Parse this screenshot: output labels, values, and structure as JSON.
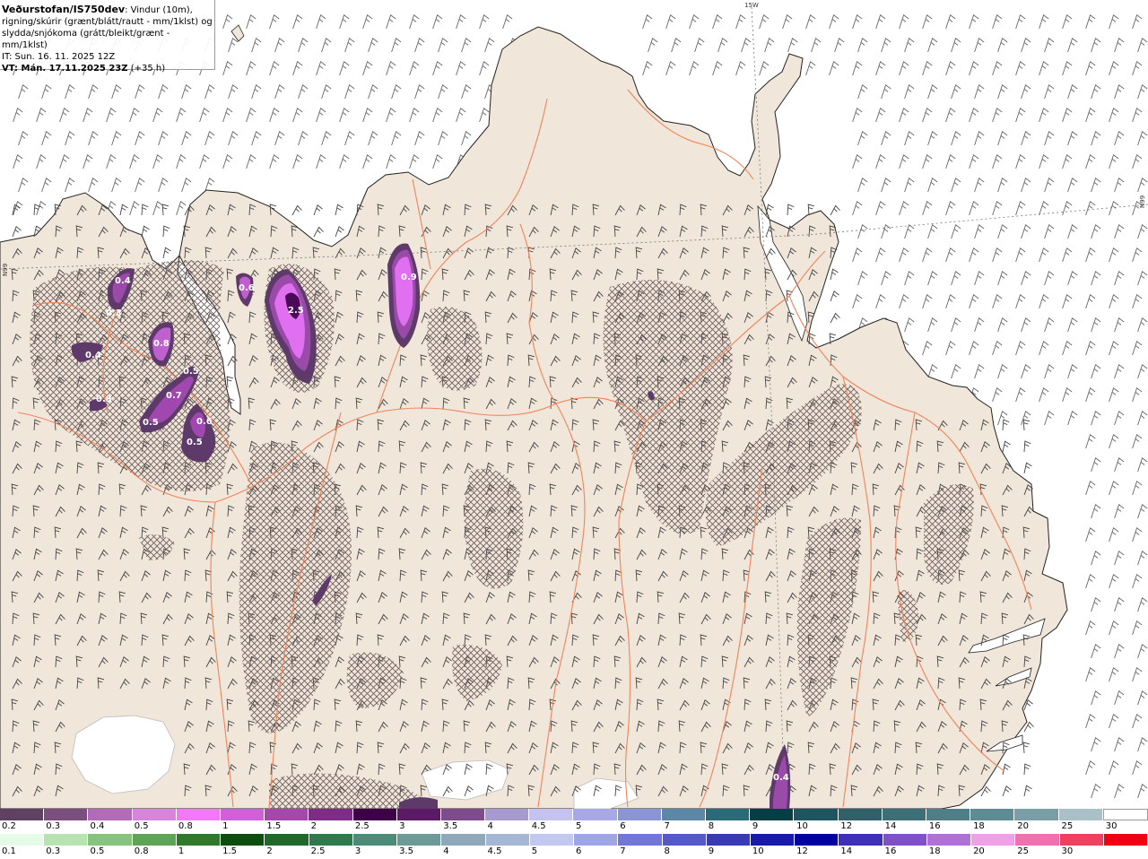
{
  "header": {
    "product": "Veðurstofan/IS750dev",
    "desc_line1": ": Vindur (10m),",
    "desc_line2": "rigning/skúrir (grænt/blátt/rautt - mm/1klst) og",
    "desc_line3": "slydda/snjókoma (grátt/bleikt/grænt - mm/1klst)",
    "issue_time": "IT: Sun. 16. 11. 2025 12Z",
    "valid_prefix": "VT: Mán. 17.11.2025 23Z",
    "valid_suffix": " (+35 h)"
  },
  "grid_labels": {
    "lon": "15W",
    "lat_left": "N99",
    "lat_right": "N99"
  },
  "precip_labels": [
    {
      "text": "0.4"
    },
    {
      "text": "0.3"
    },
    {
      "text": "0.4"
    },
    {
      "text": "0.3"
    },
    {
      "text": "0.8"
    },
    {
      "text": "0.5"
    },
    {
      "text": "0.7"
    },
    {
      "text": "0.5"
    },
    {
      "text": "0.6"
    },
    {
      "text": "0.5"
    },
    {
      "text": "0.6"
    },
    {
      "text": "2.5"
    },
    {
      "text": "0.9"
    },
    {
      "text": "0.4"
    }
  ],
  "legend_snow": {
    "ticks": [
      "0.2",
      "0.3",
      "0.4",
      "0.5",
      "0.8",
      "1",
      "1.5",
      "2",
      "2.5",
      "3",
      "3.5",
      "4",
      "4.5",
      "5",
      "6",
      "7",
      "8",
      "9",
      "10",
      "12",
      "14",
      "16",
      "18",
      "20",
      "25",
      "30"
    ],
    "colors": [
      "#5e4163",
      "#7a4f80",
      "#b16bb8",
      "#d684dc",
      "#f07af5",
      "#d060d8",
      "#a548ad",
      "#7e2c87",
      "#3e0046",
      "#5b1966",
      "#7e4b8c",
      "#a79ad1",
      "#c5c2ef",
      "#a8a8e8",
      "#8b95d6",
      "#5c88a8",
      "#2a6b7a",
      "#063e46",
      "#1d5560",
      "#30616a",
      "#3d6f78",
      "#4f7e88",
      "#5f8b94",
      "#7a9ea6",
      "#a9c0c6",
      "#ffffff"
    ]
  },
  "legend_rain": {
    "ticks": [
      "0.1",
      "0.3",
      "0.5",
      "0.8",
      "1",
      "1.5",
      "2",
      "2.5",
      "3",
      "3.5",
      "4",
      "4.5",
      "5",
      "6",
      "7",
      "8",
      "9",
      "10",
      "12",
      "14",
      "16",
      "18",
      "20",
      "25",
      "30"
    ],
    "colors": [
      "#e6fbe6",
      "#b6e3b0",
      "#86c47d",
      "#5ea455",
      "#2f7a2a",
      "#0c4d10",
      "#1f6a2a",
      "#2f7a4c",
      "#4c8b78",
      "#6d9a98",
      "#8fa8ba",
      "#a6b7d6",
      "#c2c8f2",
      "#9fa6e8",
      "#7276d8",
      "#5458c8",
      "#3a3ab4",
      "#1a1aa8",
      "#0000a0",
      "#4030b8",
      "#8050c8",
      "#b070d8",
      "#f0a0e8",
      "#f070b0",
      "#f04060",
      "#f00010"
    ]
  },
  "colors": {
    "land": "#f0e6da",
    "sea": "#ffffff",
    "roads": "#f0845a",
    "hatch": "#6a5a5a",
    "precip_dark": "#5e3a6a",
    "precip_mid": "#9a4aa8",
    "precip_light": "#e070f0"
  }
}
